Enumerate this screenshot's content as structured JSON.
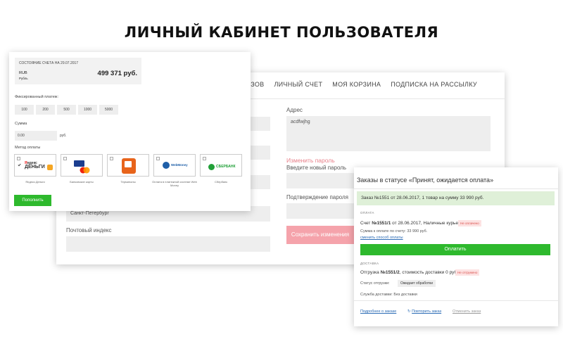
{
  "page_title": "ЛИЧНЫЙ КАБИНЕТ ПОЛЬЗОВАТЕЛЯ",
  "profile": {
    "nav": [
      "АЗОВ",
      "ЛИЧНЫЙ СЧЕТ",
      "МОЯ КОРЗИНА",
      "ПОДПИСКА НА РАССЫЛКУ"
    ],
    "address_label": "Адрес",
    "address_value": "acdfwjhg",
    "change_password": "Изменить пароль",
    "new_password_label": "Введите новый пароль",
    "confirm_password_label": "Подтверждение пароля",
    "city_value": "Санкт-Петербург",
    "zip_label": "Почтовый индекс",
    "save_button": "Сохранить изменения"
  },
  "balance": {
    "account_title": "СОСТОЯНИЕ СЧЕТА НА 29.07.2017",
    "currency_code": "RUB",
    "currency_name": "Рубль",
    "amount": "499 371 руб.",
    "fixed_label": "Фиксированный платеж:",
    "fixed_amounts": [
      "100",
      "200",
      "500",
      "1000",
      "5000"
    ],
    "sum_label": "Сумма",
    "sum_value": "0.00",
    "sum_unit": "руб.",
    "method_label": "Метод оплаты",
    "methods": [
      {
        "label": "Яндекс.Деньги",
        "logo": "ЯНДЕКС ДЕНЬГИ"
      },
      {
        "label": "Банковские карты",
        "logo": "VISA MC"
      },
      {
        "label": "Терминалы",
        "logo": "terminal"
      },
      {
        "label": "Оплата в платежной системе Web Money",
        "logo": "WebMoney"
      },
      {
        "label": "Сбербанк",
        "logo": "СБЕРБАНК"
      }
    ],
    "topup_button": "Пополнить"
  },
  "order": {
    "title": "Заказы в статусе «Принят, ожидается оплата»",
    "banner": "Заказ №1551 от 28.06.2017, 1 товар на сумму 33 990 руб.",
    "payment_section": "ОПЛАТА",
    "invoice_prefix": "Счет ",
    "invoice_bold": "№1551/1",
    "invoice_rest": " от 28.06.2017, Наличные курьеру",
    "unpaid_badge": "Не оплачено",
    "amount_due": "Сумма к оплате по счету: 33 990 руб.",
    "change_payment": "сменить способ оплаты",
    "pay_button": "Оплатить",
    "delivery_section": "ДОСТАВКА",
    "shipment_prefix": "Отгрузка ",
    "shipment_bold": "№1551/2",
    "shipment_rest": ", стоимость доставки 0 руб.",
    "not_shipped_badge": "Не отгружено",
    "shipment_status_label": "Статус отгрузки:",
    "shipment_status_value": "Ожидает обработки",
    "delivery_service": "Служба доставки: Без доставки",
    "details_link": "Подробнее о заказе",
    "repeat_link": "Повторить заказ",
    "cancel_link": "Отменить заказ"
  },
  "colors": {
    "accent_green": "#2eb92d",
    "pink_button": "#f5a3ab",
    "link_blue": "#2a6bb5",
    "badge_red": "#d9534f"
  }
}
